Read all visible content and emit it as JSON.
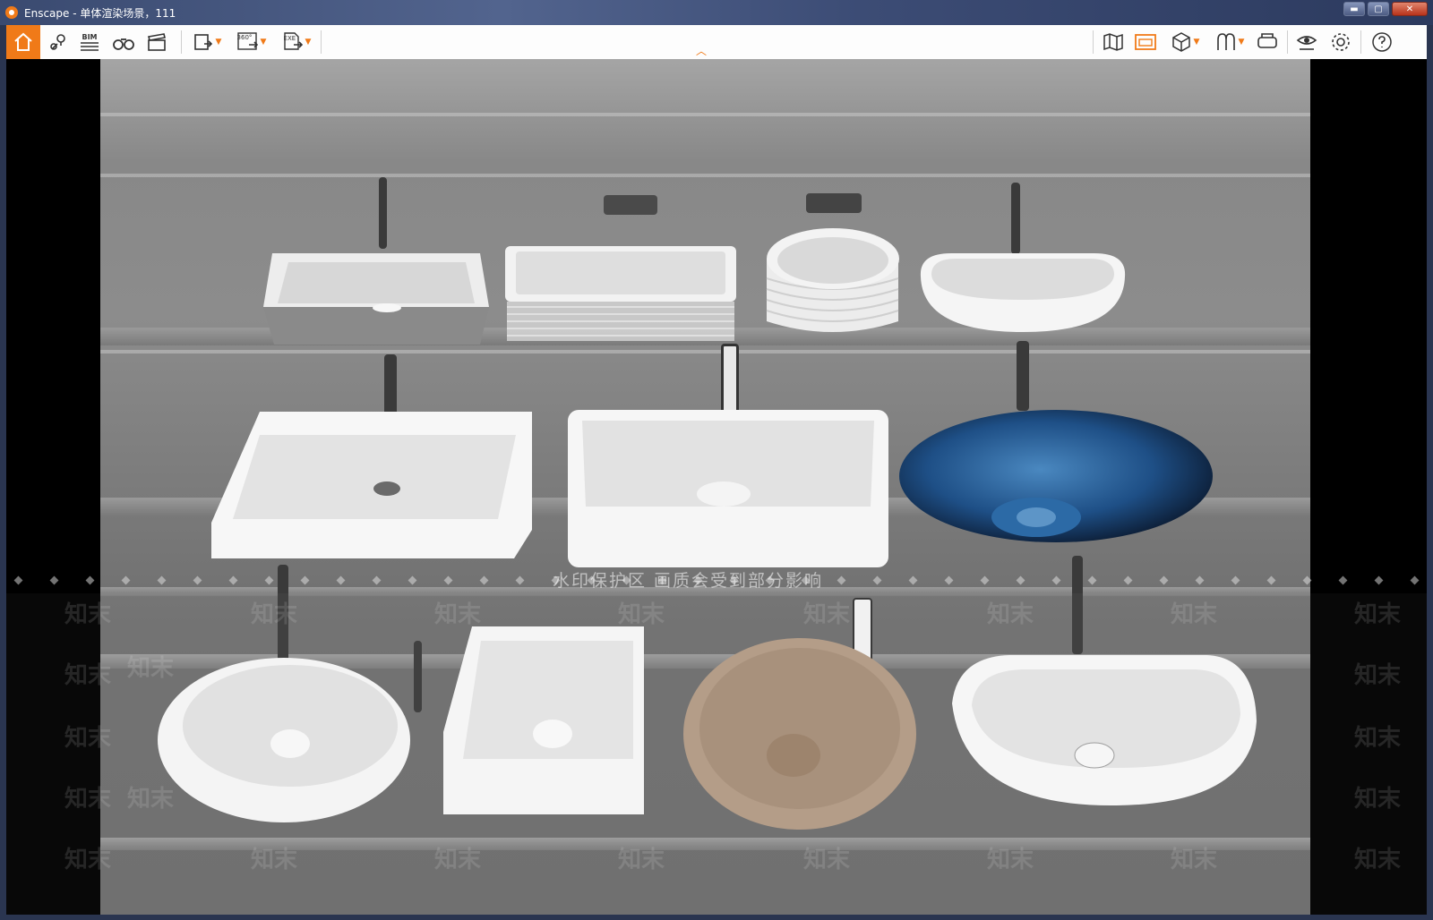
{
  "window": {
    "title": "Enscape - 单体渲染场景，111",
    "min_label": "▬",
    "max_label": "▢",
    "close_label": "✕"
  },
  "toolbar": {
    "bim_label": "BIM",
    "pano_label": "360°",
    "exe_label": "EXE"
  },
  "watermark": {
    "notice": "水印保护区   画质会受到部分影响",
    "mark": "知末"
  },
  "colors": {
    "accent": "#f07a18"
  }
}
